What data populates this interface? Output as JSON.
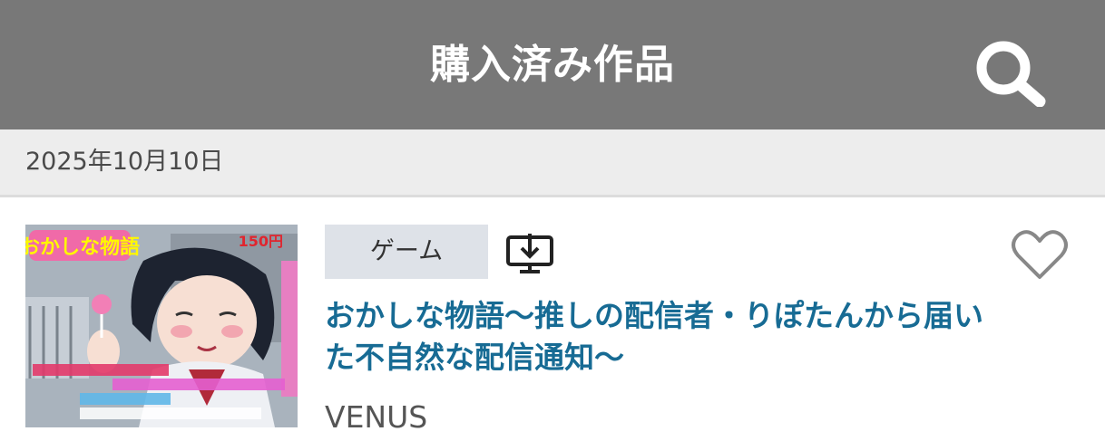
{
  "header": {
    "title": "購入済み作品",
    "search_icon": "search-icon"
  },
  "date_section": {
    "date": "2025年10月10日"
  },
  "items": [
    {
      "category": "ゲーム",
      "download_icon": "monitor-download-icon",
      "favorite_icon": "heart-outline-icon",
      "title": "おかしな物語〜推しの配信者・りぽたんから届いた不自然な配信通知〜",
      "maker": "VENUS",
      "thumbnail": {
        "logo": "おかしな物語",
        "badge": "150円"
      }
    }
  ],
  "colors": {
    "header_bg": "#787878",
    "date_bar_bg": "#ededed",
    "tag_bg": "#dee2e8",
    "title_link": "#176b94"
  }
}
